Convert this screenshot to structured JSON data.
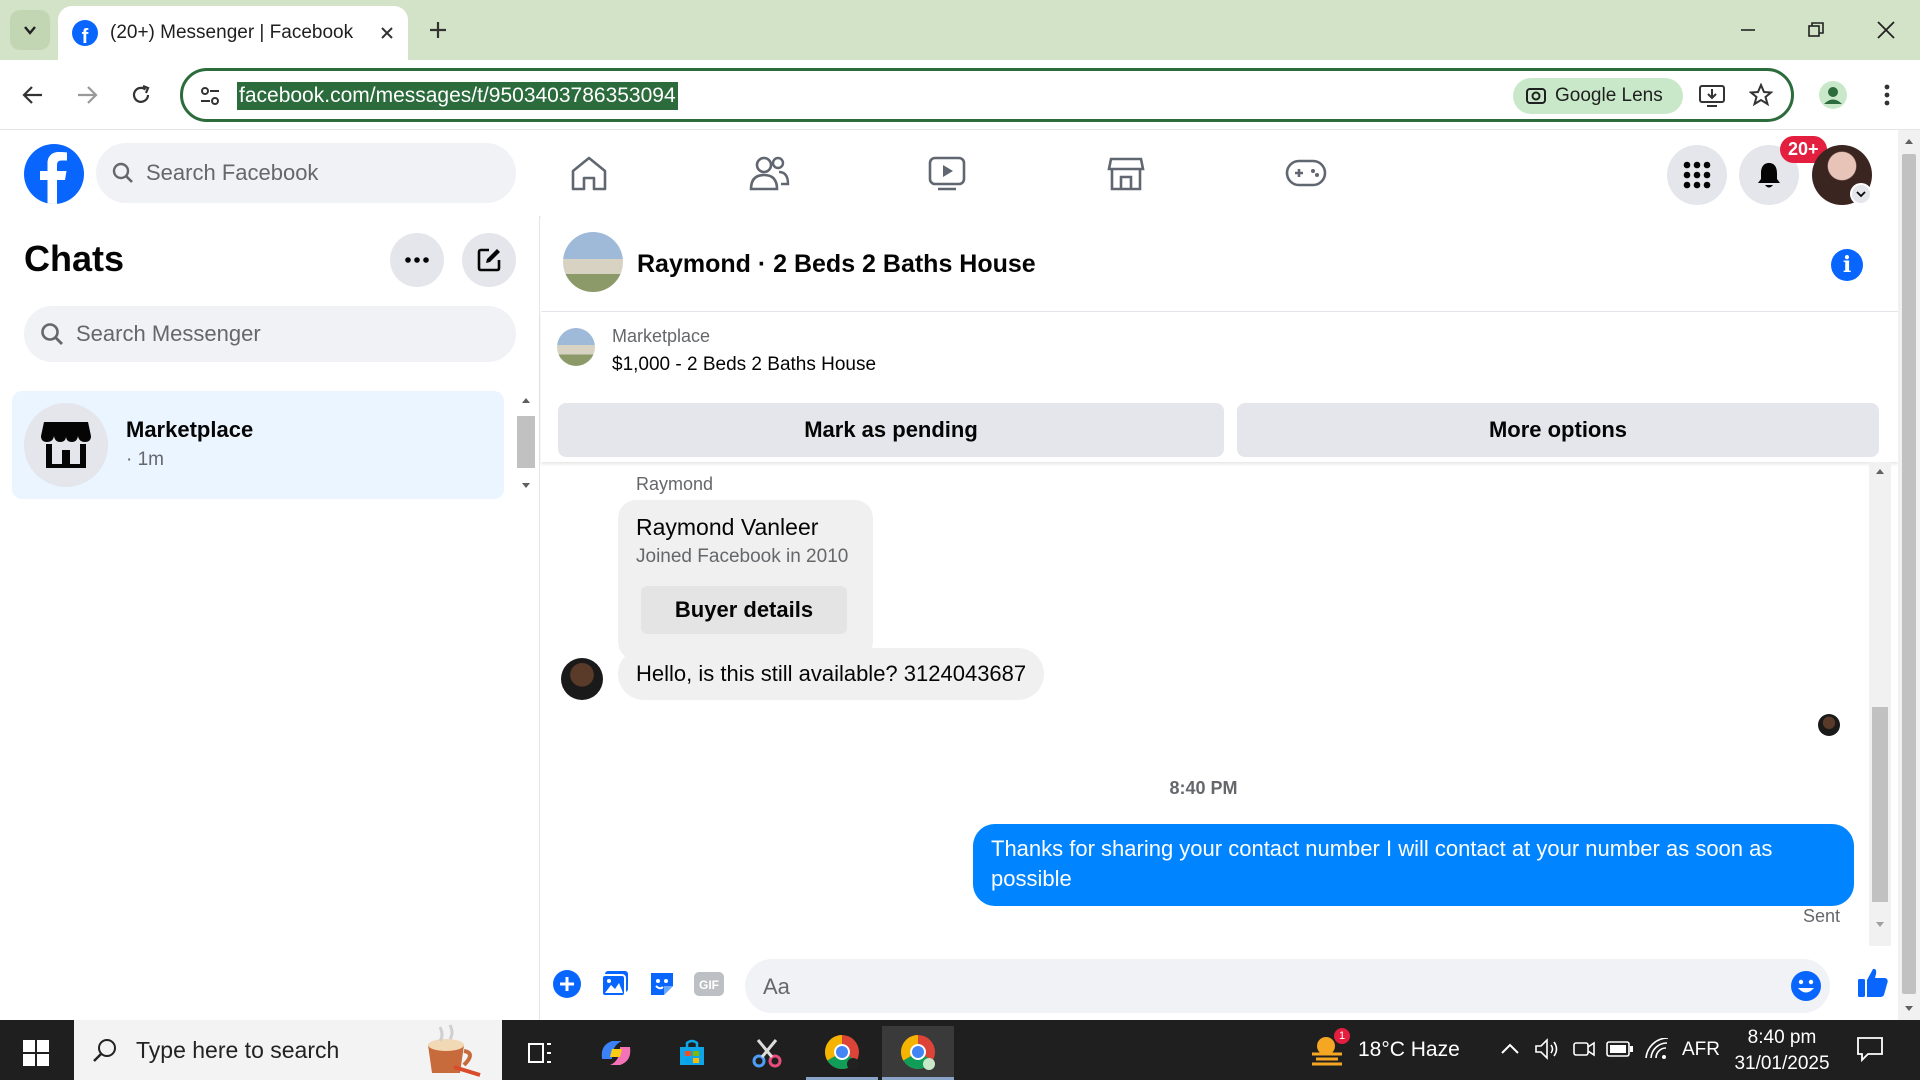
{
  "browser": {
    "tab_title": "(20+) Messenger | Facebook",
    "url": "facebook.com/messages/t/9503403786353094",
    "lens_label": "Google Lens"
  },
  "fb": {
    "search_placeholder": "Search Facebook",
    "notif_badge": "20+",
    "brand_color": "#0866ff"
  },
  "left": {
    "title": "Chats",
    "search_placeholder": "Search Messenger",
    "chats": [
      {
        "name": "Marketplace",
        "time": "· 1m"
      }
    ]
  },
  "conversation": {
    "title": "Raymond · 2 Beds 2 Baths House",
    "listing": {
      "category": "Marketplace",
      "price_title": "$1,000 - 2 Beds 2 Baths House",
      "mark_pending_label": "Mark as pending",
      "more_options_label": "More options"
    },
    "sender_label": "Raymond",
    "profile_card": {
      "name": "Raymond Vanleer",
      "subtitle": "Joined Facebook in 2010",
      "button_label": "Buyer details"
    },
    "incoming_message": "Hello, is this still available? 3124043687",
    "timestamp": "8:40 PM",
    "outgoing_message": "Thanks for sharing your contact number I will contact at your number as soon as possible",
    "outgoing_status": "Sent",
    "composer_placeholder": "Aa",
    "outgoing_color": "#0084ff"
  },
  "taskbar": {
    "search_placeholder": "Type here to search",
    "weather": "18°C  Haze",
    "weather_badge": "1",
    "language": "AFR",
    "time": "8:40 pm",
    "date": "31/01/2025"
  }
}
